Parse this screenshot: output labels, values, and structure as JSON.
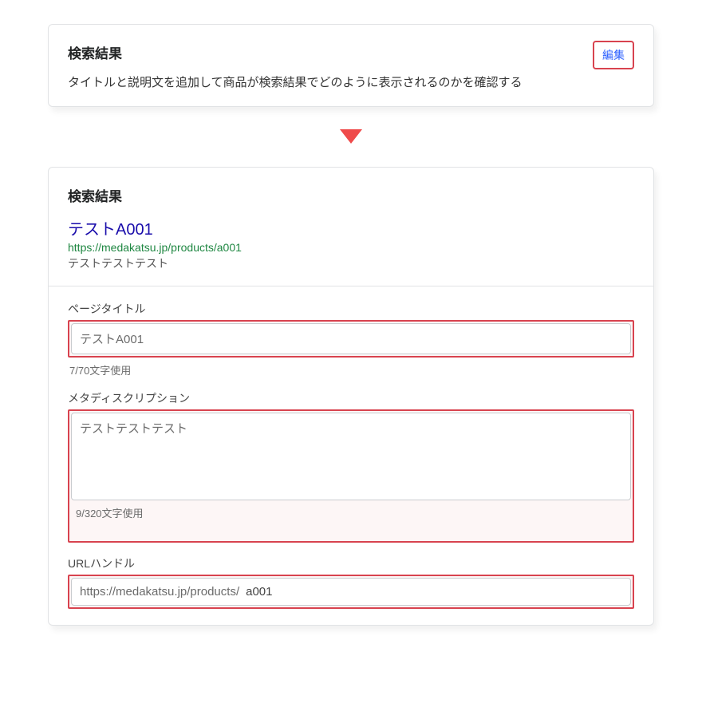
{
  "top_card": {
    "title": "検索結果",
    "subtitle": "タイトルと説明文を追加して商品が検索結果でどのように表示されるのかを確認する",
    "edit_label": "編集"
  },
  "serp_preview": {
    "section_title": "検索結果",
    "title": "テストA001",
    "url": "https://medakatsu.jp/products/a001",
    "description": "テストテストテスト"
  },
  "fields": {
    "page_title": {
      "label": "ページタイトル",
      "value": "テストA001",
      "char_count": "7/70文字使用"
    },
    "meta_description": {
      "label": "メタディスクリプション",
      "value": "テストテストテスト",
      "char_count": "9/320文字使用"
    },
    "url_handle": {
      "label": "URLハンドル",
      "prefix": "https://medakatsu.jp/products/",
      "value": "a001"
    }
  }
}
